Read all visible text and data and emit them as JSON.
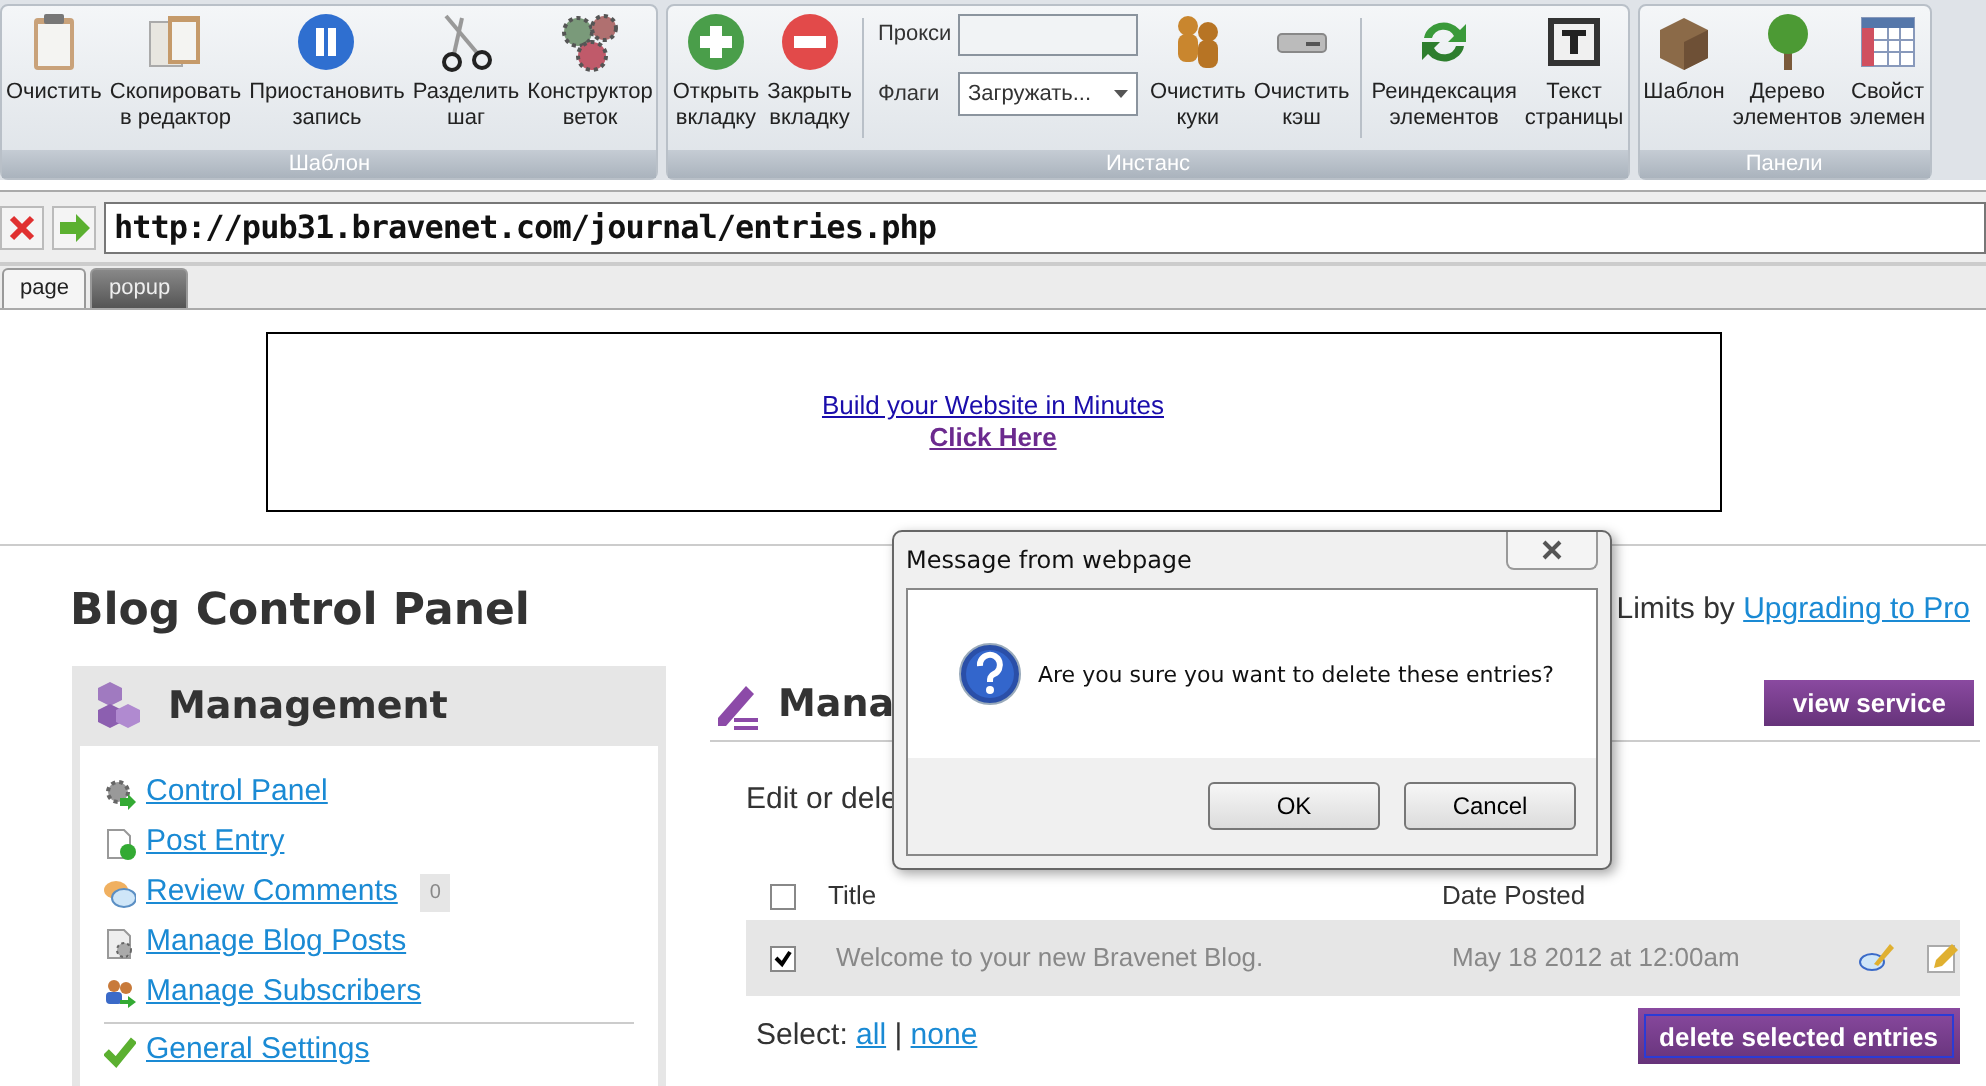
{
  "ribbon": [
    {
      "caption": "Шаблон",
      "items": [
        {
          "kind": "button",
          "lines": [
            "Очистить"
          ]
        },
        {
          "kind": "button",
          "lines": [
            "Скопировать",
            "в редактор"
          ]
        },
        {
          "kind": "button",
          "lines": [
            "Приостановить",
            "запись"
          ]
        },
        {
          "kind": "button",
          "lines": [
            "Разделить",
            "шаг"
          ]
        },
        {
          "kind": "button",
          "lines": [
            "Конструктор",
            "веток"
          ]
        }
      ]
    },
    {
      "caption": "Инстанс",
      "items": [
        {
          "kind": "button",
          "lines": [
            "Открыть",
            "вкладку"
          ]
        },
        {
          "kind": "button",
          "lines": [
            "Закрыть",
            "вкладку"
          ]
        },
        {
          "kind": "separator"
        },
        {
          "kind": "fields",
          "proxy_label": "Прокси",
          "flags_label": "Флаги",
          "flags_value": "Загружать..."
        },
        {
          "kind": "button",
          "lines": [
            "Очистить",
            "куки"
          ]
        },
        {
          "kind": "button",
          "lines": [
            "Очистить",
            "кэш"
          ]
        },
        {
          "kind": "separator"
        },
        {
          "kind": "button",
          "lines": [
            "Реиндексация",
            "элементов"
          ]
        },
        {
          "kind": "button",
          "lines": [
            "Текст",
            "страницы"
          ]
        }
      ]
    },
    {
      "caption": "Панели",
      "items": [
        {
          "kind": "button",
          "lines": [
            "Шаблон"
          ]
        },
        {
          "kind": "button",
          "lines": [
            "Дерево",
            "элементов"
          ]
        },
        {
          "kind": "button",
          "lines": [
            "Свойст",
            "элемен"
          ]
        }
      ]
    }
  ],
  "address": {
    "url": "http://pub31.bravenet.com/journal/entries.php"
  },
  "tabs": [
    {
      "label": "page",
      "selected": true
    },
    {
      "label": "popup",
      "selected": false
    }
  ],
  "ad": {
    "line1": "Build your Website in Minutes",
    "line2": "Click Here"
  },
  "page_title": "Blog Control Panel",
  "upgrade": {
    "text": "Limits by",
    "link": "Upgrading to Pro"
  },
  "sidebar": {
    "title": "Management",
    "items": [
      {
        "label": "Control Panel"
      },
      {
        "label": "Post Entry"
      },
      {
        "label": "Review Comments",
        "count": "0"
      },
      {
        "label": "Manage Blog Posts"
      },
      {
        "label": "Manage Subscribers"
      }
    ],
    "settings_items": [
      {
        "label": "General Settings"
      }
    ]
  },
  "main": {
    "heading": "Mana",
    "view_button": "view service",
    "intro": "Edit or dele",
    "header_checked": false,
    "columns": [
      "Title",
      "Date Posted"
    ],
    "rows": [
      {
        "checked": true,
        "title": "Welcome to your new Bravenet Blog.",
        "date": "May 18 2012 at 12:00am"
      }
    ],
    "select_label": "Select:",
    "select_all": "all",
    "select_separator": "|",
    "select_none": "none",
    "delete_button": "delete selected entries",
    "delete_focused": true
  },
  "dialog": {
    "title": "Message from webpage",
    "message": "Are you sure you want to delete these entries?",
    "buttons": [
      "OK",
      "Cancel"
    ]
  }
}
